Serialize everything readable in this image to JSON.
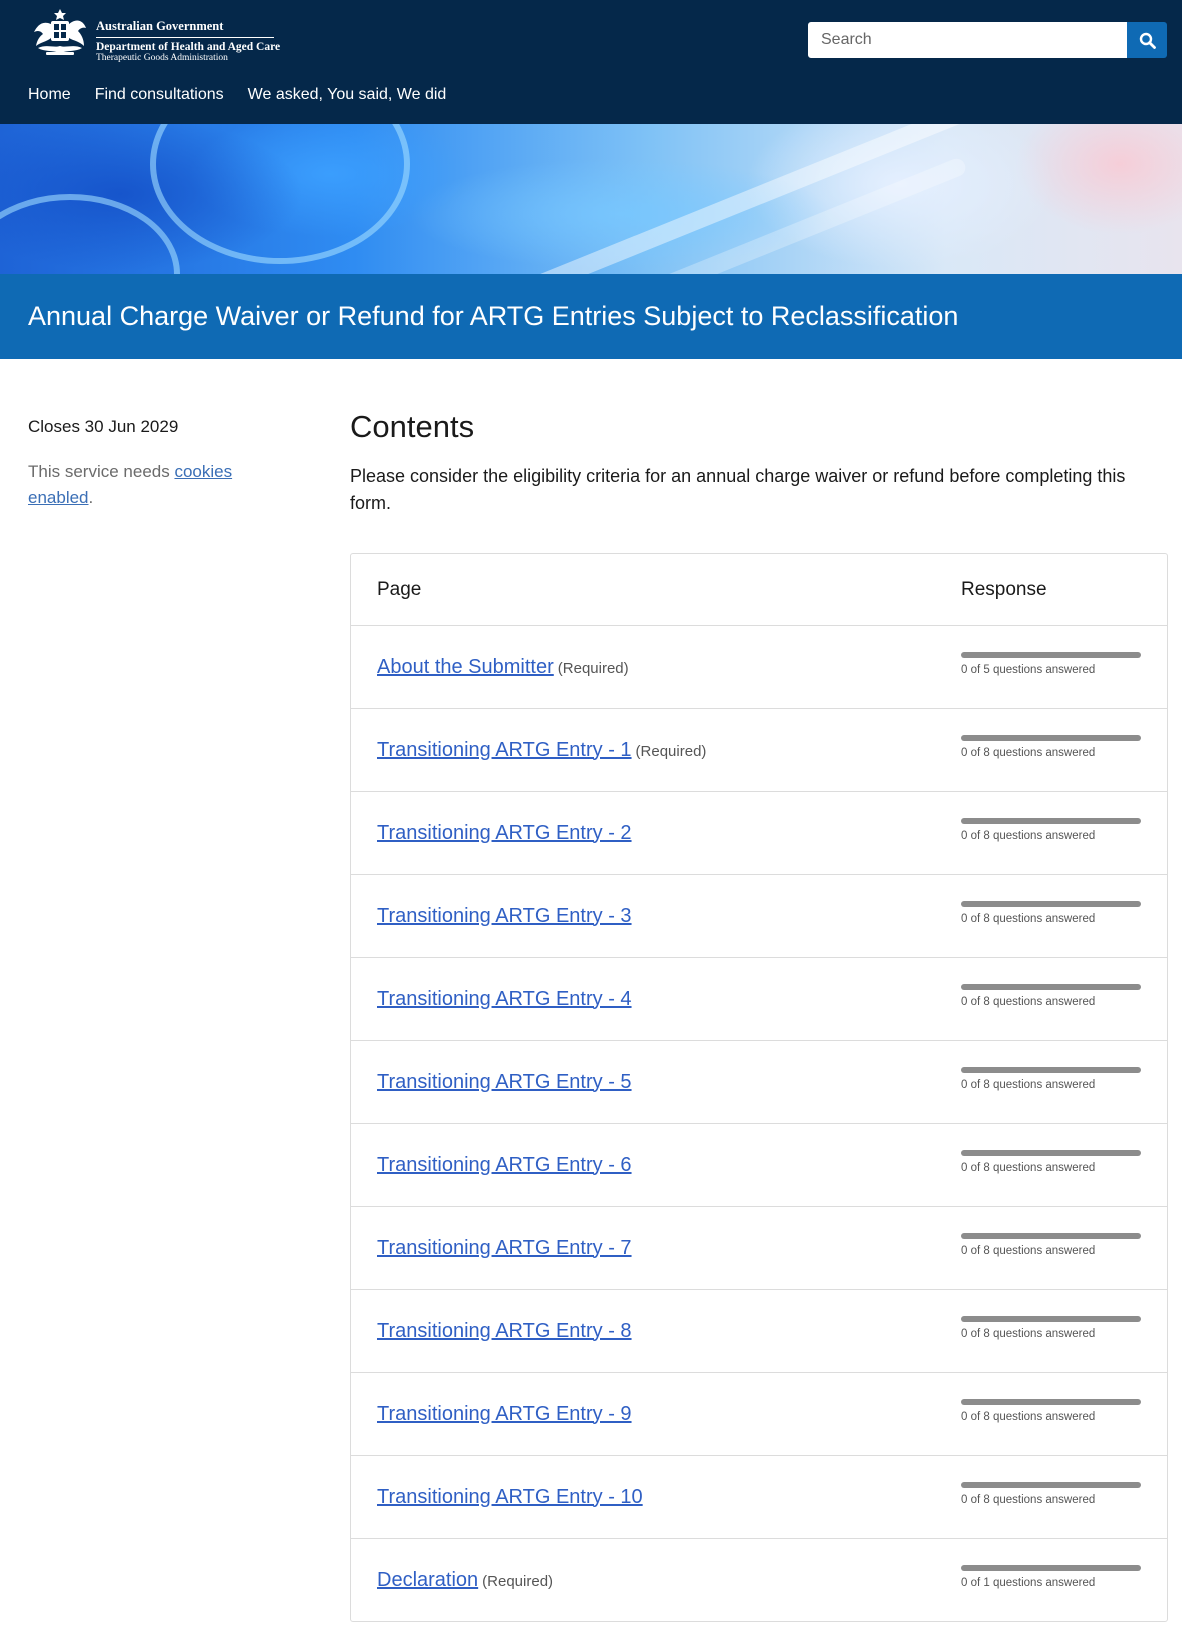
{
  "header": {
    "gov_line1": "Australian Government",
    "gov_line2": "Department of Health and Aged Care",
    "gov_line3": "Therapeutic Goods Administration",
    "search_placeholder": "Search",
    "nav": [
      "Home",
      "Find consultations",
      "We asked, You said, We did"
    ]
  },
  "page_title": "Annual Charge Waiver or Refund for ARTG Entries Subject to Reclassification",
  "sidebar": {
    "closes": "Closes 30 Jun 2029",
    "cookies_prefix": "This service needs ",
    "cookies_link": "cookies enabled",
    "cookies_suffix": "."
  },
  "contents": {
    "heading": "Contents",
    "intro": "Please consider the eligibility criteria for an annual charge waiver or refund before completing this form.",
    "col_page": "Page",
    "col_response": "Response",
    "rows": [
      {
        "label": "About the Submitter",
        "required": "(Required)",
        "answered": 0,
        "total": 5,
        "progress_text": "0 of 5 questions answered"
      },
      {
        "label": "Transitioning ARTG Entry - 1",
        "required": "(Required)",
        "answered": 0,
        "total": 8,
        "progress_text": "0 of 8 questions answered"
      },
      {
        "label": "Transitioning ARTG Entry - 2",
        "required": "",
        "answered": 0,
        "total": 8,
        "progress_text": "0 of 8 questions answered"
      },
      {
        "label": "Transitioning ARTG Entry - 3",
        "required": "",
        "answered": 0,
        "total": 8,
        "progress_text": "0 of 8 questions answered"
      },
      {
        "label": "Transitioning ARTG Entry - 4",
        "required": "",
        "answered": 0,
        "total": 8,
        "progress_text": "0 of 8 questions answered"
      },
      {
        "label": "Transitioning ARTG Entry - 5",
        "required": "",
        "answered": 0,
        "total": 8,
        "progress_text": "0 of 8 questions answered"
      },
      {
        "label": "Transitioning ARTG Entry - 6",
        "required": "",
        "answered": 0,
        "total": 8,
        "progress_text": "0 of 8 questions answered"
      },
      {
        "label": "Transitioning ARTG Entry - 7",
        "required": "",
        "answered": 0,
        "total": 8,
        "progress_text": "0 of 8 questions answered"
      },
      {
        "label": "Transitioning ARTG Entry - 8",
        "required": "",
        "answered": 0,
        "total": 8,
        "progress_text": "0 of 8 questions answered"
      },
      {
        "label": "Transitioning ARTG Entry - 9",
        "required": "",
        "answered": 0,
        "total": 8,
        "progress_text": "0 of 8 questions answered"
      },
      {
        "label": "Transitioning ARTG Entry - 10",
        "required": "",
        "answered": 0,
        "total": 8,
        "progress_text": "0 of 8 questions answered"
      },
      {
        "label": "Declaration",
        "required": "(Required)",
        "answered": 0,
        "total": 1,
        "progress_text": "0 of 1 questions answered"
      }
    ]
  },
  "colors": {
    "header_bg": "#05284a",
    "title_band": "#0f6ab4",
    "link": "#2f5fc4",
    "progress_track": "#8c8c8c"
  },
  "icons": {
    "logo": "commonwealth-crest-icon",
    "search": "search-icon"
  }
}
